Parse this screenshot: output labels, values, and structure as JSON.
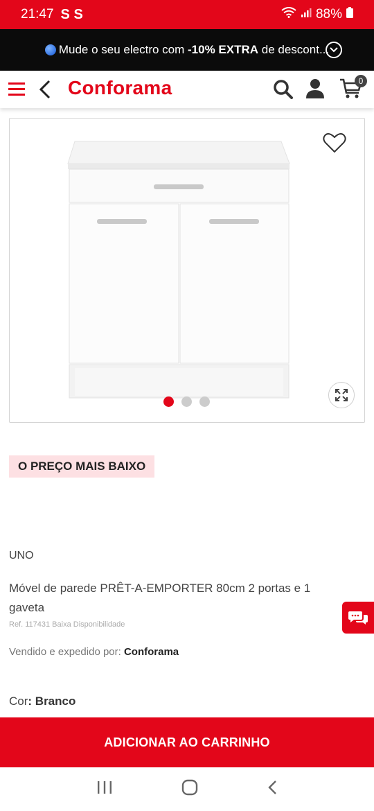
{
  "status_bar": {
    "time": "21:47",
    "indicators": "S S",
    "battery": "88%",
    "icons": [
      "wifi-icon",
      "signal-icon",
      "battery-icon"
    ]
  },
  "promo_banner": {
    "text_before": "Mude o seu electro com ",
    "text_bold": "-10% EXTRA",
    "text_after": " de descont..."
  },
  "header": {
    "logo": "Conforama",
    "cart_count": "0"
  },
  "product": {
    "badge": "O PREÇO MAIS BAIXO",
    "brand": "UNO",
    "title": "Móvel de parede PRÊT-A-EMPORTER 80cm 2 portas e 1 gaveta",
    "ref": "Ref. 117431 Baixa Disponibilidade",
    "seller_label": "Vendido e expedido por: ",
    "seller_name": "Conforama",
    "color_label": "Cor",
    "color_value": ": Branco"
  },
  "gallery": {
    "image_count": 3,
    "active_index": 0
  },
  "actions": {
    "add_to_cart": "ADICIONAR AO CARRINHO"
  },
  "colors": {
    "brand_red": "#e3061a",
    "badge_bg": "#fde0e3",
    "banner_bg": "#0b0b0b"
  }
}
